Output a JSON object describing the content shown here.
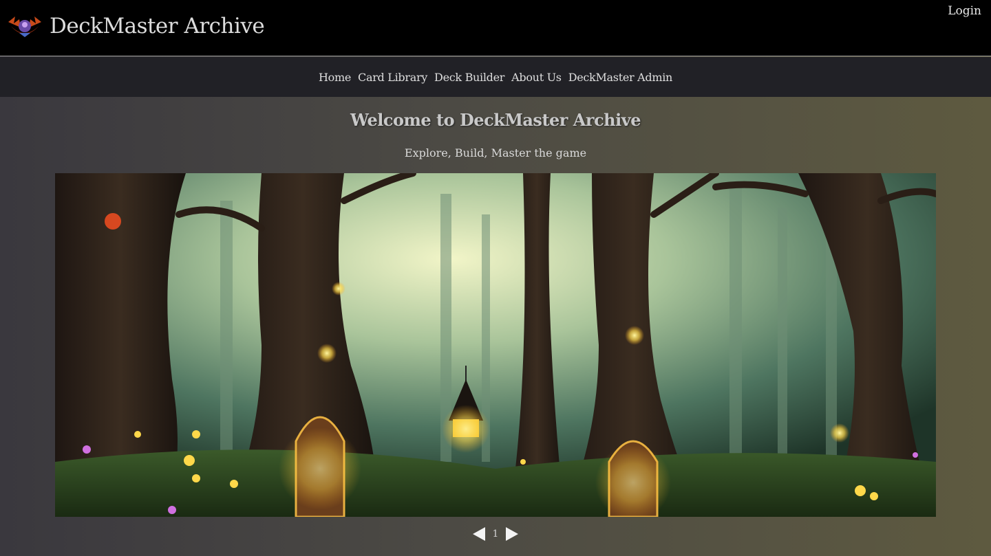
{
  "header": {
    "logo_icon": "dragon-crest-icon",
    "title": "DeckMaster Archive",
    "login_label": "Login"
  },
  "nav": {
    "items": [
      {
        "label": "Home"
      },
      {
        "label": "Card Library"
      },
      {
        "label": "Deck Builder"
      },
      {
        "label": "About Us"
      },
      {
        "label": "DeckMaster Admin"
      }
    ]
  },
  "hero": {
    "heading": "Welcome to DeckMaster Archive",
    "tagline": "Explore, Build, Master the game"
  },
  "carousel": {
    "image_subject": "enchanted forest with glowing tree houses",
    "prev_icon": "triangle-left-icon",
    "next_icon": "triangle-right-icon",
    "current_page": "1"
  },
  "colors": {
    "topbar": "#000000",
    "navbar": "#212126",
    "text": "#dcdcdc",
    "glow": "#ffd84a"
  }
}
